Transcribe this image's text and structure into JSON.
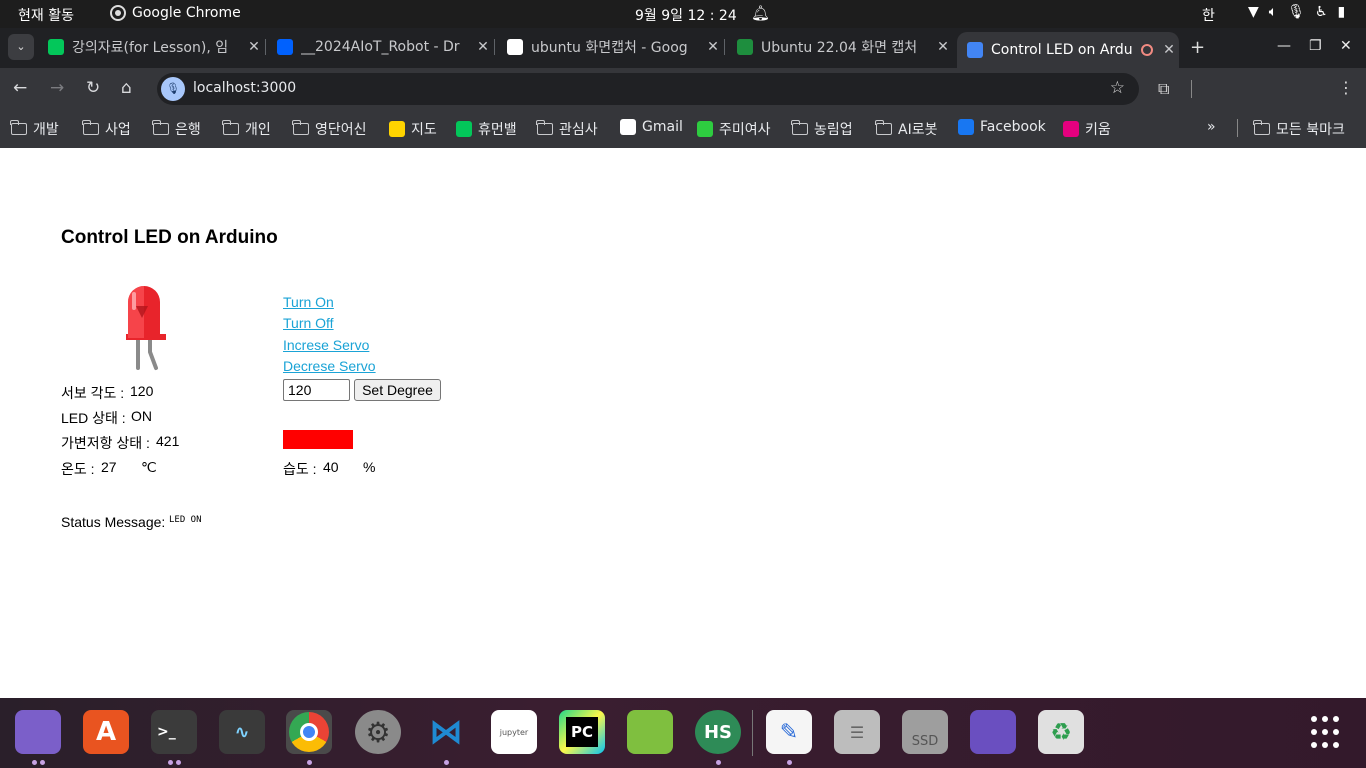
{
  "topbar": {
    "activities": "현재 활동",
    "app_name": "Google Chrome",
    "clock": "9월 9일  12 : 24",
    "ime": "한"
  },
  "tabs": [
    {
      "title": "강의자료(for Lesson), 임",
      "favicon": "blog-icon",
      "color": "#03c75a"
    },
    {
      "title": "__2024AIoT_Robot - Dr",
      "favicon": "dropbox-icon",
      "color": "#0061fe"
    },
    {
      "title": "ubuntu 화면캡처 - Goog",
      "favicon": "google-icon",
      "color": "#ffffff"
    },
    {
      "title": "Ubuntu 22.04 화면 캡처",
      "favicon": "leaf-icon",
      "color": "#1e8e3e"
    },
    {
      "title": "Control LED on Ardu",
      "favicon": "globe-icon",
      "color": "#4285f4",
      "active": true
    }
  ],
  "toolbar": {
    "url": "localhost:3000"
  },
  "bookmarks": [
    {
      "label": "개발",
      "type": "folder"
    },
    {
      "label": "사업",
      "type": "folder"
    },
    {
      "label": "은행",
      "type": "folder"
    },
    {
      "label": "개인",
      "type": "folder"
    },
    {
      "label": "영단어신",
      "type": "folder"
    },
    {
      "label": "지도",
      "type": "map-pin-icon",
      "color": "#ffd400"
    },
    {
      "label": "휴먼밸",
      "type": "blog-icon",
      "color": "#03c75a"
    },
    {
      "label": "관심사",
      "type": "folder"
    },
    {
      "label": "Gmail",
      "type": "google-icon",
      "color": "#ffffff"
    },
    {
      "label": "주미여사",
      "type": "apple-icon",
      "color": "#2ecc40"
    },
    {
      "label": "농림업",
      "type": "folder"
    },
    {
      "label": "AI로봇",
      "type": "folder"
    },
    {
      "label": "Facebook",
      "type": "facebook-icon",
      "color": "#1877f2"
    },
    {
      "label": "키움",
      "type": "kiwoom-icon",
      "color": "#e4007f"
    }
  ],
  "bookmarks_more": "»",
  "all_bookmarks": "모든 북마크",
  "page": {
    "title": "Control LED on Arduino",
    "links": {
      "turn_on": "Turn On",
      "turn_off": "Turn Off",
      "increase_servo": "Increse Servo",
      "decrease_servo": "Decrese Servo"
    },
    "servo_label": "서보 각도 : ",
    "servo_value": "120",
    "degree_input_value": "120",
    "set_degree_label": "Set Degree",
    "led_label": "LED 상태 : ",
    "led_value": "ON",
    "resistor_label": "가변저항 상태 : ",
    "resistor_value": "421",
    "temp_label": "온도 : ",
    "temp_value": "27",
    "temp_unit": "℃",
    "humidity_label": "습도 : ",
    "humidity_value": "40",
    "humidity_unit": "%",
    "status_label": "Status Message: ",
    "status_value": "LED ON",
    "swatch_color": "#ff0000"
  },
  "dock": [
    {
      "name": "files-icon",
      "color": "#7b5fc9",
      "running": 2
    },
    {
      "name": "app-center-icon",
      "color": "#e95420",
      "running": 0
    },
    {
      "name": "terminal-icon",
      "color": "#3b3b3b",
      "running": 2
    },
    {
      "name": "system-monitor-icon",
      "color": "#3a3a3a",
      "running": 0
    },
    {
      "name": "chrome-icon",
      "color": "#4a4a4a",
      "running": 1
    },
    {
      "name": "settings-icon",
      "color": "#8a8a8a",
      "running": 0
    },
    {
      "name": "vscode-icon",
      "color": "#1f8ad2",
      "running": 1
    },
    {
      "name": "jupyter-icon",
      "color": "#ffffff",
      "running": 0
    },
    {
      "name": "pycharm-icon",
      "color": "#21d789",
      "running": 0
    },
    {
      "name": "arduino-ide-icon",
      "color": "#7fbf3f",
      "running": 0
    },
    {
      "name": "hs-icon",
      "color": "#2e8b57",
      "running": 1
    },
    {
      "name": "text-editor-icon",
      "color": "#f5f5f5",
      "running": 1
    },
    {
      "name": "server-icon",
      "color": "#bdbdbd",
      "running": 0
    },
    {
      "name": "ssd-icon",
      "color": "#9e9e9e",
      "running": 0
    },
    {
      "name": "folder-icon",
      "color": "#6a4fc0",
      "running": 0
    },
    {
      "name": "trash-icon",
      "color": "#e0e0e0",
      "running": 0
    }
  ],
  "dock_ssd_label": "SSD",
  "dock_hs_label": "HS",
  "dock_pc_label": "PC",
  "dock_jupyter_label": "jupyter"
}
